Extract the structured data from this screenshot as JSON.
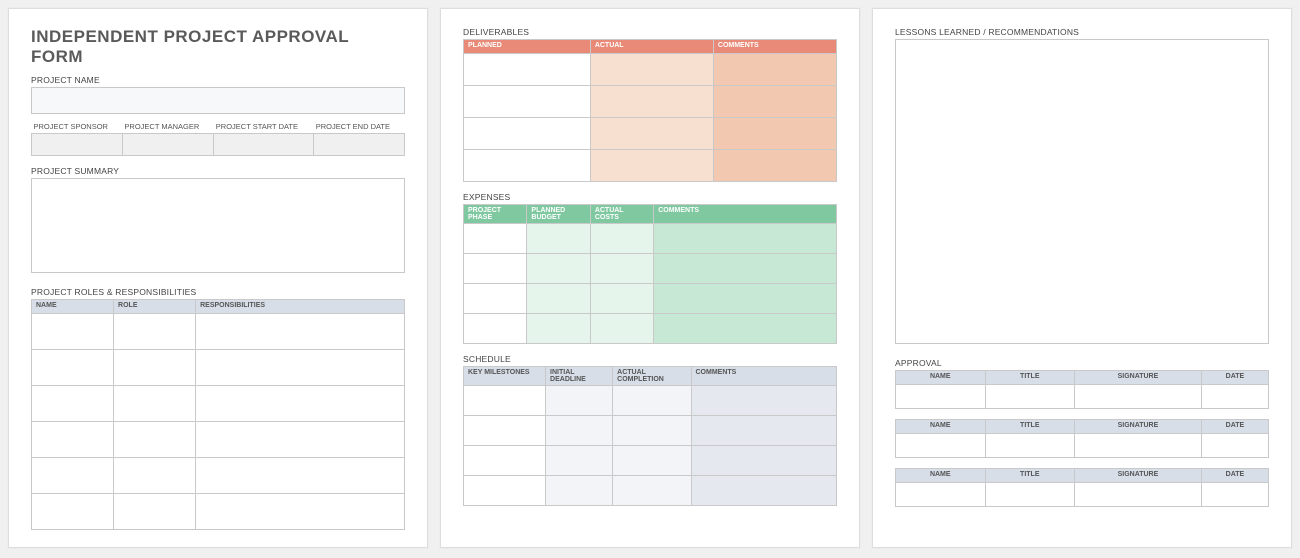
{
  "page1": {
    "title": "INDEPENDENT PROJECT APPROVAL FORM",
    "project_name_label": "PROJECT NAME",
    "meta": {
      "sponsor": "PROJECT SPONSOR",
      "manager": "PROJECT MANAGER",
      "start": "PROJECT START DATE",
      "end": "PROJECT END DATE"
    },
    "summary_label": "PROJECT SUMMARY",
    "roles_label": "PROJECT ROLES & RESPONSIBILITIES",
    "roles_headers": {
      "name": "NAME",
      "role": "ROLE",
      "resp": "RESPONSIBILITIES"
    }
  },
  "page2": {
    "deliverables_label": "DELIVERABLES",
    "deliverables_headers": {
      "planned": "PLANNED",
      "actual": "ACTUAL",
      "comments": "COMMENTS"
    },
    "expenses_label": "EXPENSES",
    "expenses_headers": {
      "phase": "PROJECT PHASE",
      "budget": "PLANNED BUDGET",
      "actual": "ACTUAL COSTS",
      "comments": "COMMENTS"
    },
    "schedule_label": "SCHEDULE",
    "schedule_headers": {
      "milestones": "KEY MILESTONES",
      "deadline": "INITIAL DEADLINE",
      "completion": "ACTUAL COMPLETION",
      "comments": "COMMENTS"
    }
  },
  "page3": {
    "lessons_label": "LESSONS LEARNED / RECOMMENDATIONS",
    "approval_label": "APPROVAL",
    "approval_headers": {
      "name": "NAME",
      "title": "TITLE",
      "signature": "SIGNATURE",
      "date": "DATE"
    }
  }
}
